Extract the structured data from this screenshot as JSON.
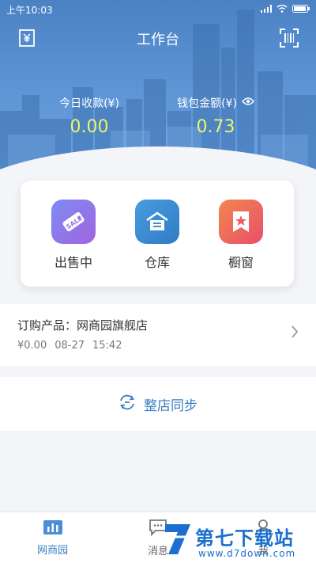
{
  "status_bar": {
    "time": "上午10:03",
    "signal": "4G",
    "battery": ""
  },
  "header": {
    "title": "工作台",
    "left_icon": "receipt-icon",
    "right_icon": "barcode-scan-icon"
  },
  "stats": {
    "today_label": "今日收款(¥)",
    "today_value": "0.00",
    "wallet_label": "钱包金额(¥)",
    "wallet_value": "0.73"
  },
  "quick_actions": [
    {
      "label": "出售中",
      "icon": "sale-tag-icon",
      "color": "#8a74e8"
    },
    {
      "label": "仓库",
      "icon": "warehouse-icon",
      "color": "#3f8fd2"
    },
    {
      "label": "橱窗",
      "icon": "showcase-star-icon",
      "color": "#ef6b5a"
    }
  ],
  "order": {
    "title": "订购产品：网商园旗舰店",
    "amount": "¥0.00",
    "date": "08-27",
    "time": "15:42"
  },
  "sync": {
    "label": "整店同步"
  },
  "tabs": [
    {
      "label": "网商园",
      "icon": "chart-icon",
      "active": true
    },
    {
      "label": "消息",
      "icon": "message-icon",
      "active": false
    },
    {
      "label": "我",
      "icon": "user-icon",
      "active": false
    }
  ],
  "watermark": {
    "text": "第七下载站",
    "url": "www.d7down.com"
  }
}
